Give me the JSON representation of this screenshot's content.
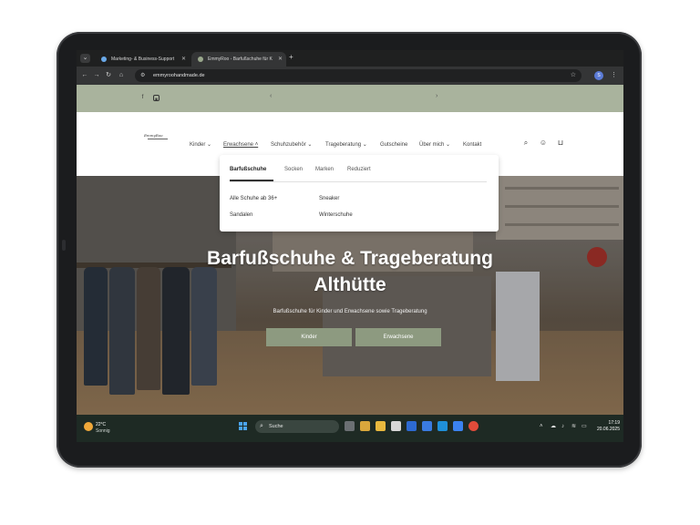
{
  "browser": {
    "tabs": [
      {
        "title": "Marketing- & Business-Support",
        "active": false
      },
      {
        "title": "EmmyRoo - Barfußschuhe für K",
        "active": true
      }
    ],
    "url": "emmyroohandmade.de"
  },
  "page": {
    "nav": {
      "items": [
        "Kinder",
        "Erwachsene",
        "Schuhzubehör",
        "Trageberatung",
        "Gutscheine",
        "Über mich",
        "Kontakt"
      ]
    },
    "dropdown": {
      "tabs": [
        "Barfußschuhe",
        "Socken",
        "Marken",
        "Reduziert"
      ],
      "links": [
        "Alle Schuhe ab 36+",
        "Sneaker",
        "Sandalen",
        "Winterschuhe"
      ]
    },
    "hero": {
      "title_line1": "Barfußschuhe & Trageberatung",
      "title_line2": "Althütte",
      "subtitle": "Barfußschuhe für Kinder und Erwachsene sowie Trageberatung",
      "buttons": [
        "Kinder",
        "Erwachsene"
      ]
    }
  },
  "taskbar": {
    "weather_temp": "22°C",
    "weather_desc": "Sonnig",
    "search_placeholder": "Suche",
    "clock_time": "17:19",
    "clock_date": "20.06.2025"
  },
  "colors": {
    "announcement_bar": "#a9b39d",
    "hero_button": "#8d9a80",
    "taskbar": "#1e2a24"
  }
}
